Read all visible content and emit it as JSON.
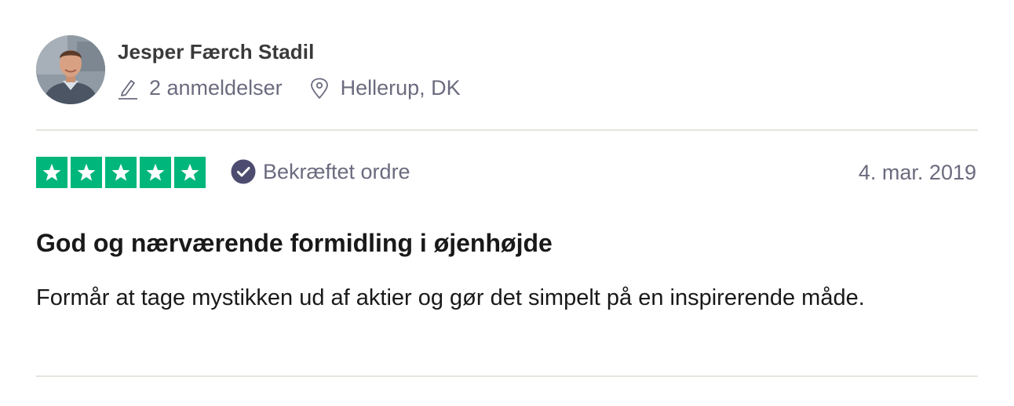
{
  "reviewer": {
    "name": "Jesper Færch Stadil",
    "reviews_count_label": "2 anmeldelser",
    "location": "Hellerup, DK",
    "avatar_icon": "user-photo"
  },
  "rating": {
    "stars": 5,
    "max_stars": 5,
    "star_color": "#00b67a",
    "verified_label": "Bekræftet ordre",
    "date": "4. mar. 2019"
  },
  "review": {
    "title": "God og nærværende formidling i øjenhøjde",
    "body": "Formår at tage mystikken ud af aktier og gør det simpelt på en inspirerende måde."
  },
  "icons": {
    "reviews": "pencil-icon",
    "location": "location-pin-icon",
    "verified": "check-circle-icon",
    "star": "star-icon"
  },
  "colors": {
    "text_primary": "#191919",
    "text_secondary": "#6b6b7f",
    "divider": "#e5e5dd",
    "verified_badge": "#4d4c70"
  }
}
